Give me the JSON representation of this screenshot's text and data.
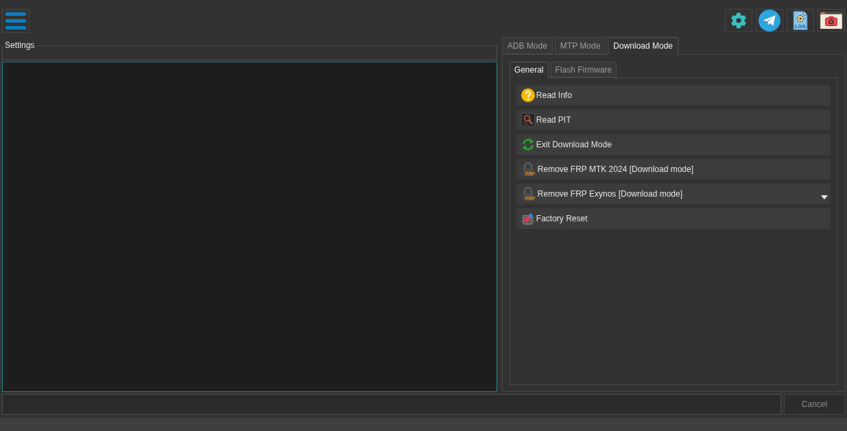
{
  "toolbar": {
    "icons": [
      {
        "kind": "settings"
      },
      {
        "kind": "telegram"
      },
      {
        "kind": "log",
        "text": "LOG"
      },
      {
        "kind": "screenshot"
      }
    ]
  },
  "settings_group": {
    "title": "Settings"
  },
  "tabs": [
    {
      "label": "ADB Mode",
      "selected": false
    },
    {
      "label": "MTP Mode",
      "selected": false
    },
    {
      "label": "Download Mode",
      "selected": true
    }
  ],
  "subtabs": [
    {
      "label": "General",
      "selected": true
    },
    {
      "label": "Flash Firmware",
      "selected": false
    }
  ],
  "actions": [
    {
      "label": "Read Info",
      "kind": "info",
      "has_menu": false
    },
    {
      "label": "Read PIT",
      "kind": "pit",
      "has_menu": false
    },
    {
      "label": "Exit Download Mode",
      "kind": "exit",
      "has_menu": false
    },
    {
      "label": "Remove FRP MTK 2024 [Download mode]",
      "kind": "frp",
      "icon_text": "FRP",
      "has_menu": false
    },
    {
      "label": "Remove FRP Exynos [Download mode]",
      "kind": "frp",
      "icon_text": "FRP",
      "has_menu": true
    },
    {
      "label": "Factory Reset",
      "kind": "reset",
      "has_menu": false
    }
  ],
  "cancel_button": {
    "label": "Cancel",
    "disabled": true
  }
}
